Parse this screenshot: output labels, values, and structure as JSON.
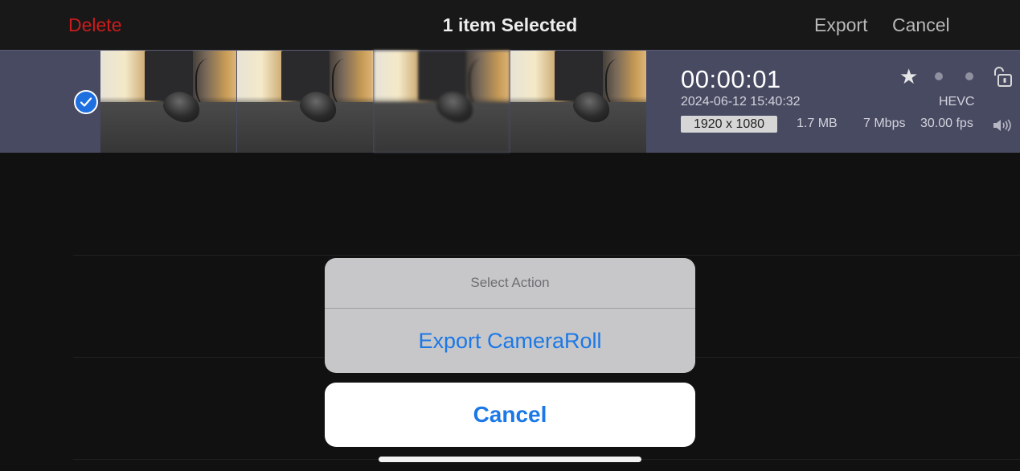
{
  "topbar": {
    "delete_label": "Delete",
    "title": "1 item Selected",
    "export_label": "Export",
    "cancel_label": "Cancel"
  },
  "clip": {
    "selected": true,
    "duration": "00:00:01",
    "datetime": "2024-06-12 15:40:32",
    "codec": "HEVC",
    "resolution": "1920 x 1080",
    "size": "1.7 MB",
    "bitrate": "7 Mbps",
    "fps": "30.00 fps",
    "icons": [
      "check-icon",
      "star-icon",
      "dot-icon",
      "dot-icon",
      "lock-icon",
      "speaker-icon"
    ]
  },
  "action_sheet": {
    "title": "Select Action",
    "actions": [
      {
        "label": "Export CameraRoll"
      }
    ],
    "cancel_label": "Cancel"
  },
  "colors": {
    "accent": "#1b78e6",
    "destructive": "#cc1c1c",
    "selected_row": "#484a62",
    "background": "#141414"
  }
}
